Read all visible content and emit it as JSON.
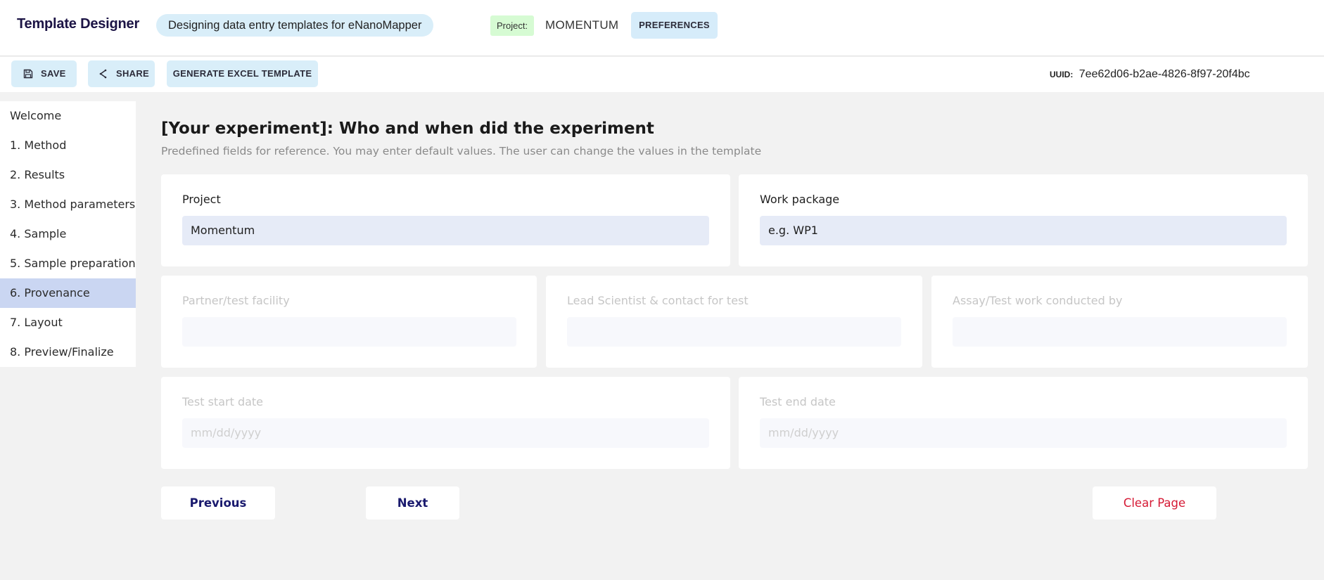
{
  "header": {
    "app_title": "Template Designer",
    "subtitle": "Designing data entry templates for eNanoMapper",
    "project_label": "Project:",
    "project_name": "MOMENTUM",
    "preferences_label": "PREFERENCES"
  },
  "toolbar": {
    "save_label": "SAVE",
    "save_icon": "floppy-disk-icon",
    "share_label": "SHARE",
    "share_icon": "share-icon",
    "excel_label": "GENERATE EXCEL TEMPLATE",
    "uuid_label": "UUID:",
    "uuid_value": "7ee62d06-b2ae-4826-8f97-20f4bc"
  },
  "sidebar": {
    "items": [
      {
        "label": "Welcome"
      },
      {
        "label": "1. Method"
      },
      {
        "label": "2. Results"
      },
      {
        "label": "3. Method parameters"
      },
      {
        "label": "4. Sample"
      },
      {
        "label": "5. Sample preparation"
      },
      {
        "label": "6. Provenance",
        "active": true
      },
      {
        "label": "7. Layout"
      },
      {
        "label": "8. Preview/Finalize"
      }
    ]
  },
  "main": {
    "title": "[Your experiment]: Who and when did the experiment",
    "description": "Predefined fields for reference. You may enter default values. The user can change the values in the template",
    "fields": {
      "project": {
        "label": "Project",
        "value": "Momentum",
        "placeholder": ""
      },
      "work_package": {
        "label": "Work package",
        "value": "",
        "placeholder": "e.g. WP1"
      },
      "partner": {
        "label": "Partner/test facility",
        "value": "",
        "placeholder": ""
      },
      "lead_scientist": {
        "label": "Lead Scientist & contact for test",
        "value": "",
        "placeholder": ""
      },
      "conducted_by": {
        "label": "Assay/Test work conducted by",
        "value": "",
        "placeholder": ""
      },
      "start_date": {
        "label": "Test start date",
        "value": "",
        "placeholder": "mm/dd/yyyy"
      },
      "end_date": {
        "label": "Test end date",
        "value": "",
        "placeholder": "mm/dd/yyyy"
      }
    },
    "buttons": {
      "previous": "Previous",
      "next": "Next",
      "clear": "Clear Page"
    }
  },
  "colors": {
    "accent_light_blue": "#d9eef9",
    "active_nav": "#cad6f2",
    "project_tag": "#d6fbd3",
    "danger": "#d51a35",
    "nav_button_text": "#1a1a6e"
  }
}
